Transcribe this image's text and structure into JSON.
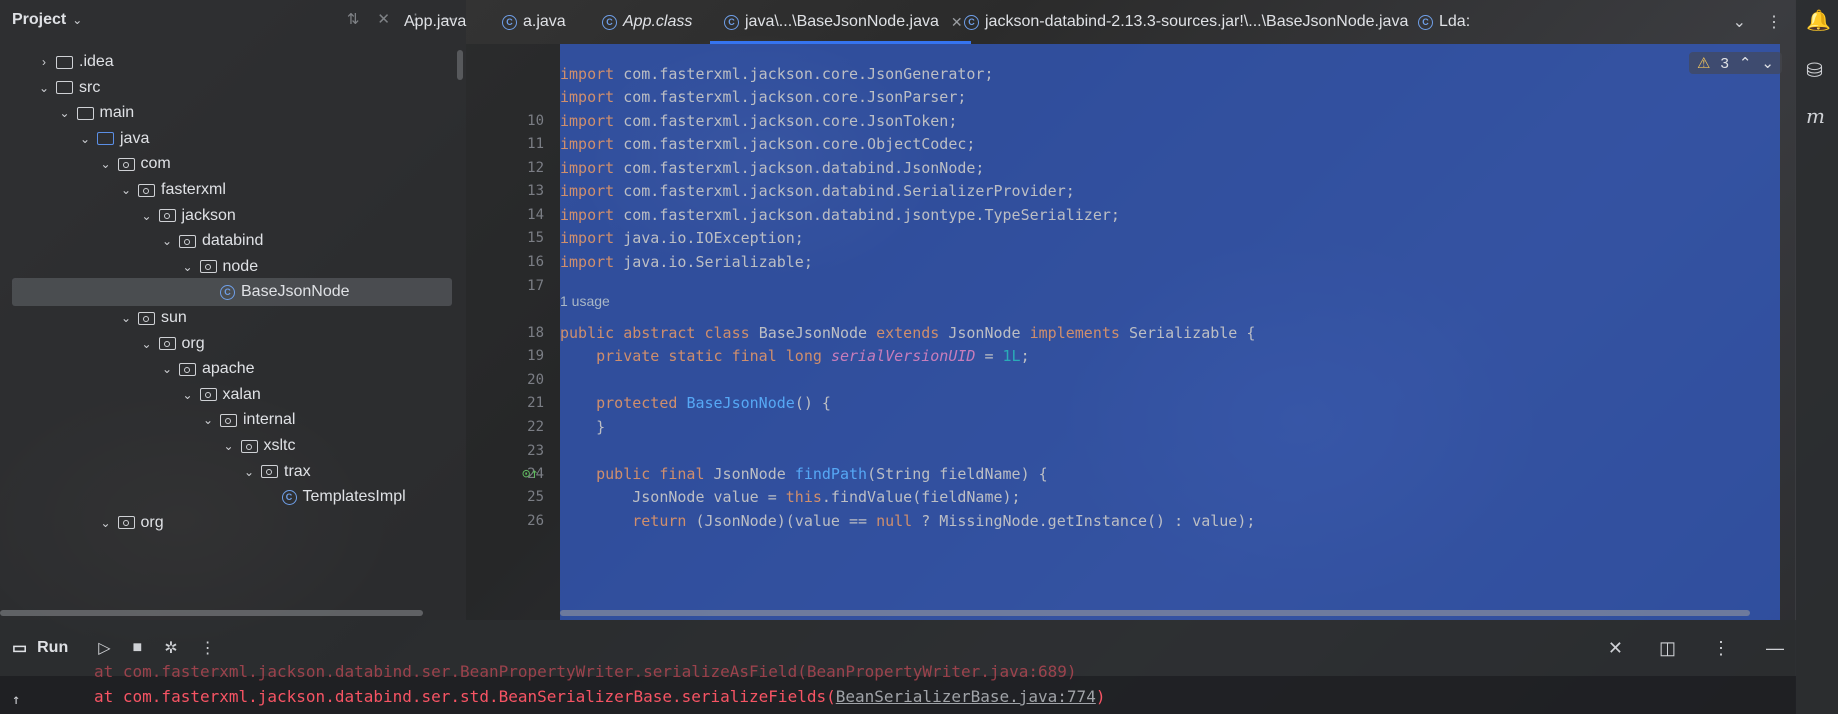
{
  "project": {
    "title": "Project",
    "tree": [
      {
        "label": ".idea",
        "depth": 1,
        "arrow": "›",
        "icon": "folder"
      },
      {
        "label": "src",
        "depth": 1,
        "arrow": "⌄",
        "icon": "folder"
      },
      {
        "label": "main",
        "depth": 2,
        "arrow": "⌄",
        "icon": "folder"
      },
      {
        "label": "java",
        "depth": 3,
        "arrow": "⌄",
        "icon": "folder-blue"
      },
      {
        "label": "com",
        "depth": 4,
        "arrow": "⌄",
        "icon": "package"
      },
      {
        "label": "fasterxml",
        "depth": 5,
        "arrow": "⌄",
        "icon": "package"
      },
      {
        "label": "jackson",
        "depth": 6,
        "arrow": "⌄",
        "icon": "package"
      },
      {
        "label": "databind",
        "depth": 7,
        "arrow": "⌄",
        "icon": "package"
      },
      {
        "label": "node",
        "depth": 8,
        "arrow": "⌄",
        "icon": "package"
      },
      {
        "label": "BaseJsonNode",
        "depth": 9,
        "arrow": "",
        "icon": "class",
        "selected": true
      },
      {
        "label": "sun",
        "depth": 5,
        "arrow": "⌄",
        "icon": "package"
      },
      {
        "label": "org",
        "depth": 6,
        "arrow": "⌄",
        "icon": "package"
      },
      {
        "label": "apache",
        "depth": 7,
        "arrow": "⌄",
        "icon": "package"
      },
      {
        "label": "xalan",
        "depth": 8,
        "arrow": "⌄",
        "icon": "package"
      },
      {
        "label": "internal",
        "depth": 9,
        "arrow": "⌄",
        "icon": "package"
      },
      {
        "label": "xsltc",
        "depth": 10,
        "arrow": "⌄",
        "icon": "package"
      },
      {
        "label": "trax",
        "depth": 11,
        "arrow": "⌄",
        "icon": "package"
      },
      {
        "label": "TemplatesImpl",
        "depth": 12,
        "arrow": "",
        "icon": "class"
      },
      {
        "label": "org",
        "depth": 4,
        "arrow": "⌄",
        "icon": "package"
      }
    ]
  },
  "tabs": [
    {
      "label": "App.java",
      "icon": false,
      "italic": false
    },
    {
      "label": "a.java",
      "icon": true,
      "italic": false
    },
    {
      "label": "App.class",
      "icon": true,
      "italic": true
    },
    {
      "label": "java\\...\\BaseJsonNode.java",
      "icon": true,
      "italic": false,
      "active": true
    },
    {
      "label": "jackson-databind-2.13.3-sources.jar!\\...\\BaseJsonNode.java",
      "icon": true,
      "italic": false
    },
    {
      "label": "Lda:",
      "icon": true,
      "italic": false
    }
  ],
  "editor": {
    "warning_count": "3",
    "usage_hint": "1 usage",
    "lines": [
      {
        "n": "",
        "segments": [
          {
            "t": "import ",
            "c": "kw"
          },
          {
            "t": "com.fasterxml.jackson.core.JsonGenerator;",
            "c": ""
          }
        ]
      },
      {
        "n": "",
        "segments": [
          {
            "t": "import ",
            "c": "kw"
          },
          {
            "t": "com.fasterxml.jackson.core.JsonParser;",
            "c": ""
          }
        ]
      },
      {
        "n": "10",
        "segments": [
          {
            "t": "import ",
            "c": "kw"
          },
          {
            "t": "com.fasterxml.jackson.core.JsonToken;",
            "c": ""
          }
        ]
      },
      {
        "n": "11",
        "segments": [
          {
            "t": "import ",
            "c": "kw"
          },
          {
            "t": "com.fasterxml.jackson.core.ObjectCodec;",
            "c": ""
          }
        ]
      },
      {
        "n": "12",
        "segments": [
          {
            "t": "import ",
            "c": "kw"
          },
          {
            "t": "com.fasterxml.jackson.databind.JsonNode;",
            "c": ""
          }
        ]
      },
      {
        "n": "13",
        "segments": [
          {
            "t": "import ",
            "c": "kw"
          },
          {
            "t": "com.fasterxml.jackson.databind.SerializerProvider;",
            "c": ""
          }
        ]
      },
      {
        "n": "14",
        "segments": [
          {
            "t": "import ",
            "c": "kw"
          },
          {
            "t": "com.fasterxml.jackson.databind.jsontype.TypeSerializer;",
            "c": ""
          }
        ]
      },
      {
        "n": "15",
        "segments": [
          {
            "t": "import ",
            "c": "kw"
          },
          {
            "t": "java.io.IOException;",
            "c": ""
          }
        ]
      },
      {
        "n": "16",
        "segments": [
          {
            "t": "import ",
            "c": "kw"
          },
          {
            "t": "java.io.Serializable;",
            "c": ""
          }
        ]
      },
      {
        "n": "17",
        "segments": []
      },
      {
        "n": "18",
        "segments": [
          {
            "t": "public abstract class ",
            "c": "kw"
          },
          {
            "t": "BaseJsonNode ",
            "c": ""
          },
          {
            "t": "extends ",
            "c": "kw"
          },
          {
            "t": "JsonNode ",
            "c": ""
          },
          {
            "t": "implements ",
            "c": "kw"
          },
          {
            "t": "Serializable {",
            "c": ""
          }
        ]
      },
      {
        "n": "19",
        "segments": [
          {
            "t": "    private static final long ",
            "c": "kw"
          },
          {
            "t": "serialVersionUID",
            "c": "fld"
          },
          {
            "t": " = ",
            "c": ""
          },
          {
            "t": "1L",
            "c": "num"
          },
          {
            "t": ";",
            "c": ""
          }
        ]
      },
      {
        "n": "20",
        "segments": []
      },
      {
        "n": "21",
        "segments": [
          {
            "t": "    protected ",
            "c": "kw"
          },
          {
            "t": "BaseJsonNode",
            "c": "fn"
          },
          {
            "t": "() {",
            "c": ""
          }
        ]
      },
      {
        "n": "22",
        "segments": [
          {
            "t": "    }",
            "c": ""
          }
        ]
      },
      {
        "n": "23",
        "segments": []
      },
      {
        "n": "24",
        "segments": [
          {
            "t": "    public final ",
            "c": "kw"
          },
          {
            "t": "JsonNode ",
            "c": ""
          },
          {
            "t": "findPath",
            "c": "fn"
          },
          {
            "t": "(String fieldName) {",
            "c": ""
          }
        ]
      },
      {
        "n": "25",
        "segments": [
          {
            "t": "        JsonNode value = ",
            "c": ""
          },
          {
            "t": "this",
            "c": "kw"
          },
          {
            "t": ".findValue(fieldName);",
            "c": ""
          }
        ]
      },
      {
        "n": "26",
        "segments": [
          {
            "t": "        return ",
            "c": "kw"
          },
          {
            "t": "(JsonNode)(value == ",
            "c": ""
          },
          {
            "t": "null",
            "c": "kw"
          },
          {
            "t": " ? MissingNode.getInstance() : value);",
            "c": ""
          }
        ]
      }
    ]
  },
  "run": {
    "title": "Run",
    "console_partial": "at com.fasterxml.jackson.databind.ser.BeanPropertyWriter.serializeAsField(BeanPropertyWriter.java:689)",
    "console_line_prefix": "at com.fasterxml.jackson.databind.ser.std.BeanSerializerBase.serializeFields(",
    "console_link": "BeanSerializerBase.java:774",
    "console_line_suffix": ")"
  }
}
